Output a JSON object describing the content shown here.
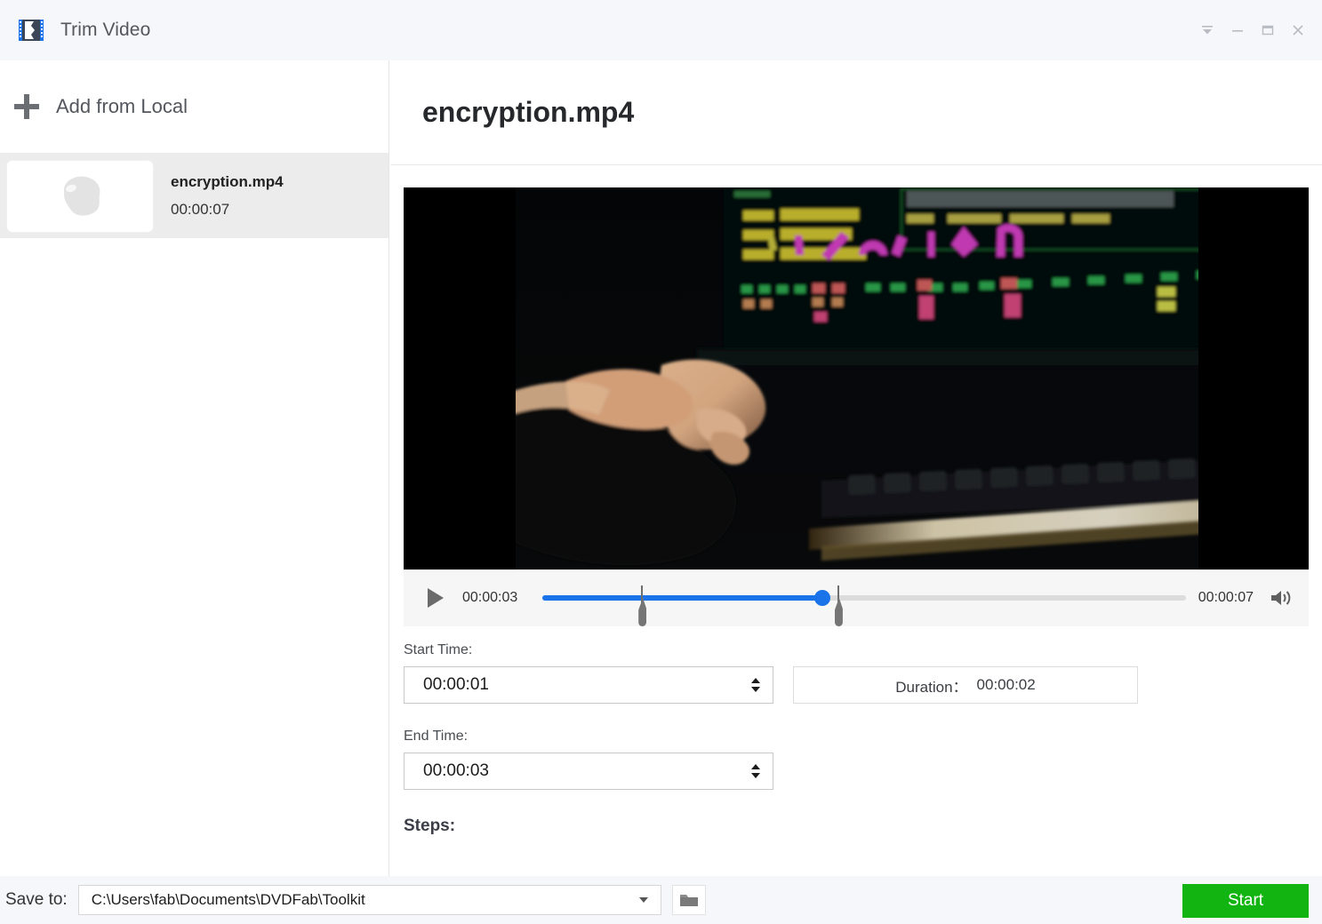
{
  "window": {
    "title": "Trim Video",
    "app_icon": "film-strip-icon",
    "controls": {
      "collapse": "collapse-icon",
      "minimize": "minimize-icon",
      "maximize": "maximize-icon",
      "close": "close-icon"
    }
  },
  "sidebar": {
    "add_from_local": "Add from Local",
    "add_icon": "plus-icon",
    "files": [
      {
        "name": "encryption.mp4",
        "duration": "00:00:07",
        "thumbnail_icon": "media-placeholder-icon",
        "selected": true
      }
    ]
  },
  "main": {
    "title": "encryption.mp4",
    "player": {
      "play_icon": "play-icon",
      "current_time": "00:00:03",
      "total_time": "00:00:07",
      "volume_icon": "speaker-icon",
      "progress_percent": 43.5,
      "trim_start_percent": 15.5,
      "trim_end_percent": 46.0
    },
    "form": {
      "start_time_label": "Start Time:",
      "start_time_value": "00:00:01",
      "end_time_label": "End Time:",
      "end_time_value": "00:00:03",
      "duration_label": "Duration：",
      "duration_value": "00:00:02",
      "steps_label": "Steps:"
    }
  },
  "bottom": {
    "save_to_label": "Save to:",
    "save_path": "C:\\Users\\fab\\Documents\\DVDFab\\Toolkit",
    "browse_icon": "folder-icon",
    "dropdown_icon": "chevron-down-icon",
    "start_label": "Start"
  },
  "colors": {
    "accent_blue": "#1a73e8",
    "start_green": "#11b411",
    "titlebar_bg": "#f5f7fa",
    "selected_row": "#ececec"
  }
}
